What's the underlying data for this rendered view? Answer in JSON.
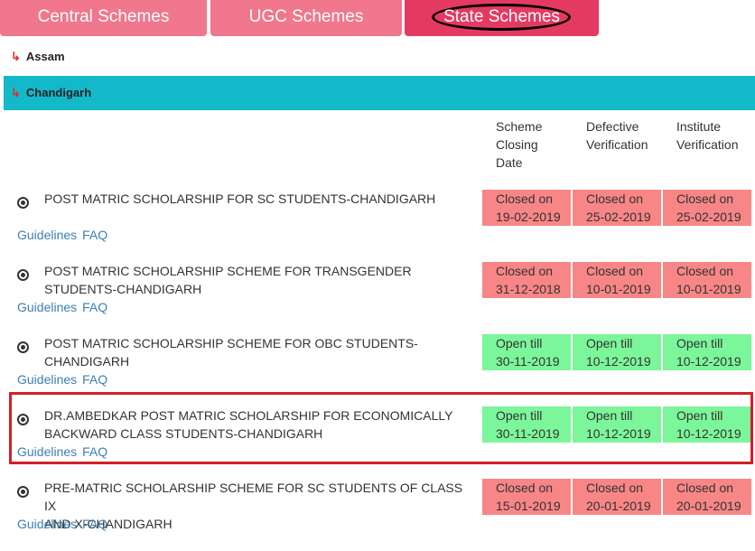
{
  "tabs": [
    {
      "label": "Central Schemes"
    },
    {
      "label": "UGC Schemes"
    },
    {
      "label": "State Schemes"
    }
  ],
  "states": [
    {
      "name": "Assam"
    },
    {
      "name": "Chandigarh"
    }
  ],
  "columns": {
    "closing": [
      "Scheme",
      "Closing",
      "Date"
    ],
    "defective": [
      "Defective",
      "Verification"
    ],
    "institute": [
      "Institute",
      "Verification"
    ]
  },
  "links": {
    "guidelines": "Guidelines",
    "faq": "FAQ"
  },
  "schemes": [
    {
      "title": [
        "POST MATRIC SCHOLARSHIP FOR SC STUDENTS-CHANDIGARH",
        ""
      ],
      "status": [
        "Closed on",
        "Closed on",
        "Closed on"
      ],
      "dates": [
        "19-02-2019",
        "25-02-2019",
        "25-02-2019"
      ],
      "state": "closed"
    },
    {
      "title": [
        "POST MATRIC SCHOLARSHIP SCHEME FOR TRANSGENDER",
        "STUDENTS-CHANDIGARH"
      ],
      "status": [
        "Closed on",
        "Closed on",
        "Closed on"
      ],
      "dates": [
        "31-12-2018",
        "10-01-2019",
        "10-01-2019"
      ],
      "state": "closed"
    },
    {
      "title": [
        "POST MATRIC SCHOLARSHIP SCHEME FOR OBC STUDENTS-",
        "CHANDIGARH"
      ],
      "status": [
        "Open till",
        "Open till",
        "Open till"
      ],
      "dates": [
        "30-11-2019",
        "10-12-2019",
        "10-12-2019"
      ],
      "state": "open"
    },
    {
      "title": [
        "DR.AMBEDKAR POST MATRIC SCHOLARSHIP FOR ECONOMICALLY",
        "BACKWARD CLASS STUDENTS-CHANDIGARH"
      ],
      "status": [
        "Open till",
        "Open till",
        "Open till"
      ],
      "dates": [
        "30-11-2019",
        "10-12-2019",
        "10-12-2019"
      ],
      "state": "open"
    },
    {
      "title": [
        "PRE-MATRIC SCHOLARSHIP SCHEME FOR SC STUDENTS OF CLASS IX",
        "AND X-CHANDIGARH"
      ],
      "status": [
        "Closed on",
        "Closed on",
        "Closed on"
      ],
      "dates": [
        "15-01-2019",
        "20-01-2019",
        "20-01-2019"
      ],
      "state": "closed"
    }
  ],
  "colors": {
    "tab": "#f0778d",
    "tab_active": "#e43a62",
    "header_bar": "#13b9c9",
    "closed": "#f98686",
    "open": "#7cf69a",
    "highlight": "#d42026"
  }
}
